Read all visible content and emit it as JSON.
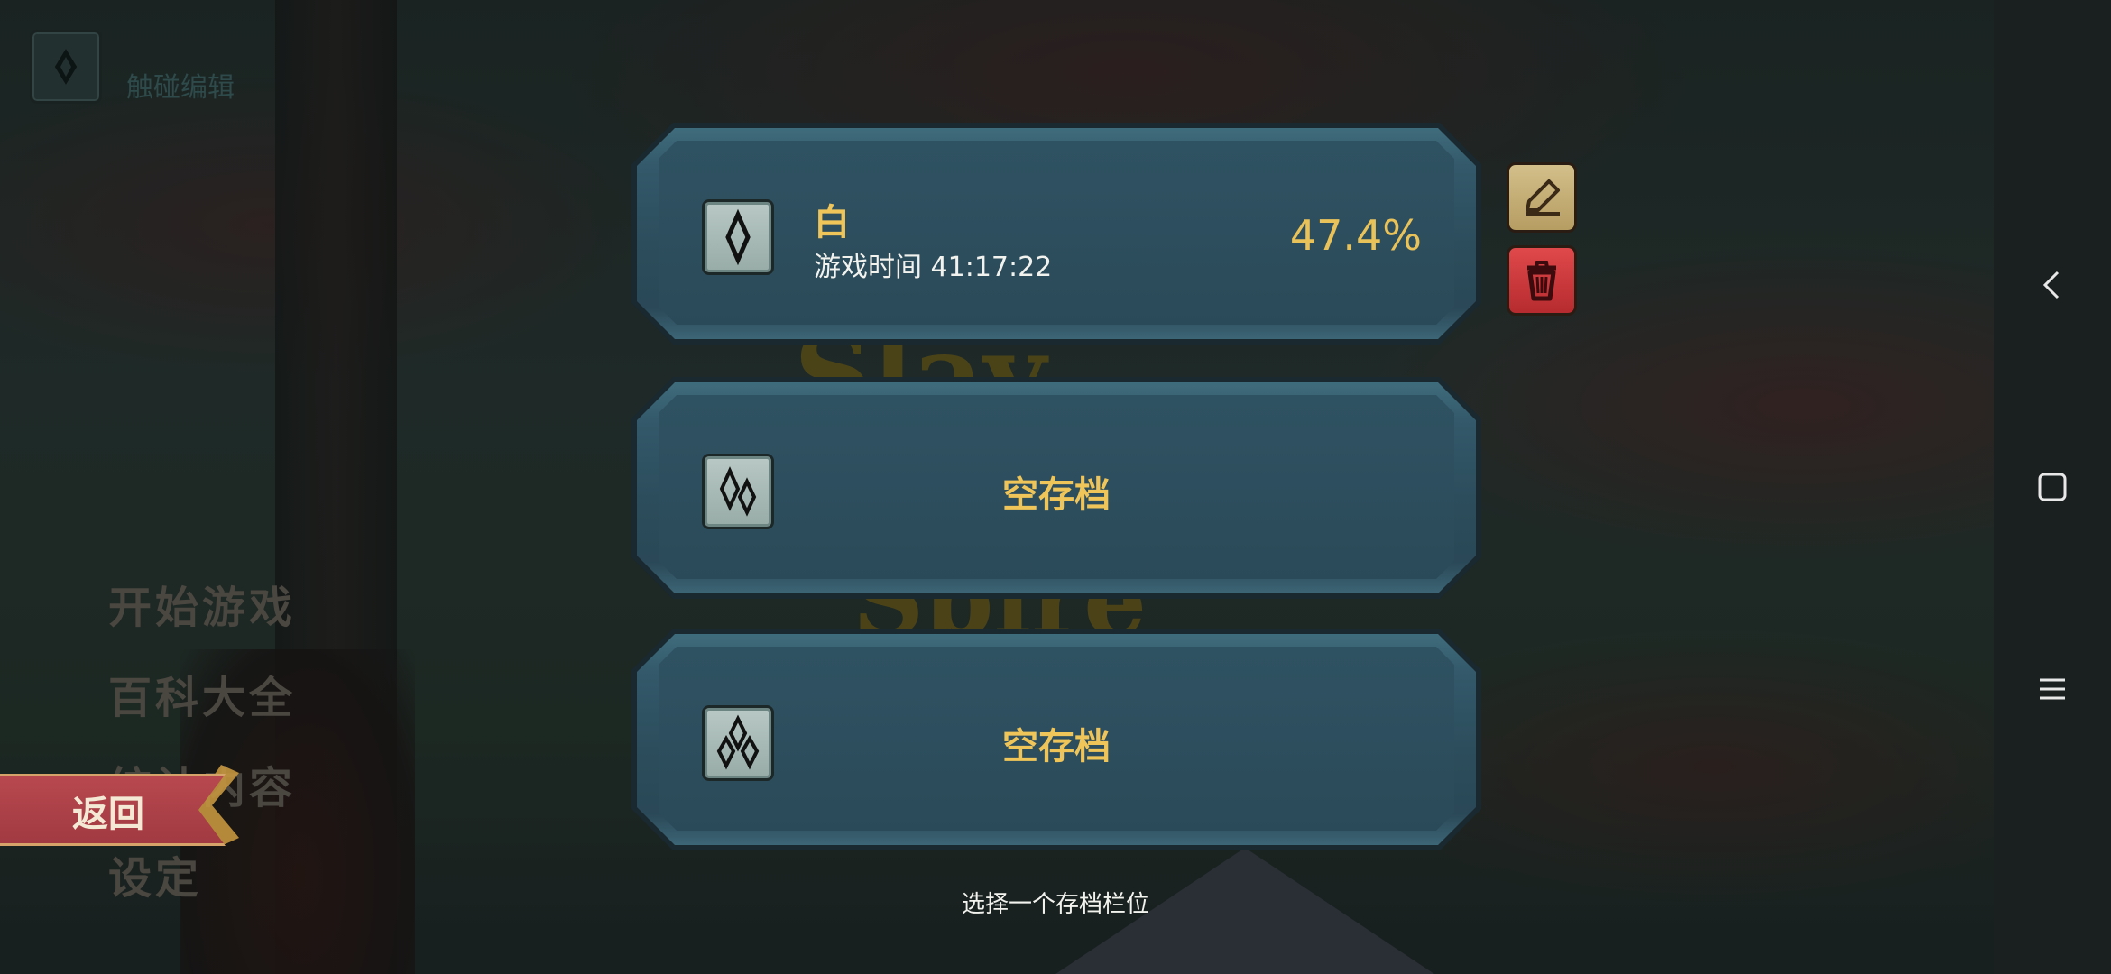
{
  "touch_edit": {
    "label": "触碰编辑"
  },
  "background_logo": {
    "line1": "Slay",
    "line2": "Spire"
  },
  "main_menu": {
    "items": [
      {
        "label": "开始游戏"
      },
      {
        "label": "百科大全"
      },
      {
        "label": "统计内容"
      },
      {
        "label": "设定"
      }
    ]
  },
  "back": {
    "label": "返回"
  },
  "save_slots": [
    {
      "name": "白",
      "play_time": "游戏时间 41:17:22",
      "progress": "47.4%",
      "empty_label": ""
    },
    {
      "name": "",
      "play_time": "",
      "progress": "",
      "empty_label": "空存档"
    },
    {
      "name": "",
      "play_time": "",
      "progress": "",
      "empty_label": "空存档"
    }
  ],
  "slot_actions": {
    "rename_icon": "pencil-icon",
    "delete_icon": "trash-icon"
  },
  "hint": "选择一个存档栏位",
  "nav": {
    "back_icon": "chevron-left-icon",
    "home_icon": "square-icon",
    "menu_icon": "hamburger-icon"
  },
  "colors": {
    "gold": "#efc55a",
    "slot_teal": "#2f5262",
    "back_red": "#b8484f",
    "delete_red": "#d63a3e"
  }
}
